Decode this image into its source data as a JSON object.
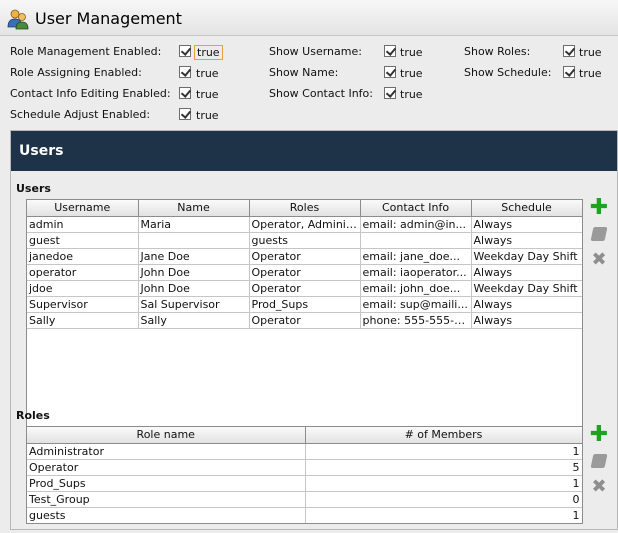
{
  "window": {
    "title": "User Management"
  },
  "properties": [
    {
      "label": "Role Management Enabled:",
      "value": "true",
      "focused": true
    },
    {
      "label": "Role Assigning Enabled:",
      "value": "true"
    },
    {
      "label": "Contact Info Editing Enabled:",
      "value": "true"
    },
    {
      "label": "Schedule Adjust Enabled:",
      "value": "true"
    },
    {
      "label": "Show Username:",
      "value": "true"
    },
    {
      "label": "Show Name:",
      "value": "true"
    },
    {
      "label": "Show Contact Info:",
      "value": "true"
    },
    {
      "label": "Show Roles:",
      "value": "true"
    },
    {
      "label": "Show Schedule:",
      "value": "true"
    }
  ],
  "panel": {
    "title": "Users"
  },
  "users": {
    "label": "Users",
    "columns": [
      "Username",
      "Name",
      "Roles",
      "Contact Info",
      "Schedule"
    ],
    "rows": [
      [
        "admin",
        "Maria",
        "Operator, Adminis...",
        "email: admin@in...",
        "Always"
      ],
      [
        "guest",
        "",
        "guests",
        "",
        "Always"
      ],
      [
        "janedoe",
        "Jane Doe",
        "Operator",
        "email: jane_doe...",
        "Weekday Day Shift"
      ],
      [
        "operator",
        "John Doe",
        "Operator",
        "email: iaoperator...",
        "Always"
      ],
      [
        "jdoe",
        "John Doe",
        "Operator",
        "email: john_doe...",
        "Weekday Day Shift"
      ],
      [
        "Supervisor",
        "Sal Supervisor",
        "Prod_Sups",
        "email: sup@maili...",
        "Always"
      ],
      [
        "Sally",
        "Sally",
        "Operator",
        "phone: 555-555-5...",
        "Always"
      ]
    ]
  },
  "roles": {
    "label": "Roles",
    "columns": [
      "Role name",
      "# of Members"
    ],
    "rows": [
      [
        "Administrator",
        "1"
      ],
      [
        "Operator",
        "5"
      ],
      [
        "Prod_Sups",
        "1"
      ],
      [
        "Test_Group",
        "0"
      ],
      [
        "guests",
        "1"
      ]
    ]
  },
  "icons": {
    "add": "plus-icon",
    "edit": "edit-icon",
    "delete": "delete-icon",
    "title": "users-icon"
  },
  "colors": {
    "panel_header": "#1e3347",
    "add": "#1fa31f",
    "disabled": "#9a9a9a",
    "focus": "#e5a23c"
  }
}
